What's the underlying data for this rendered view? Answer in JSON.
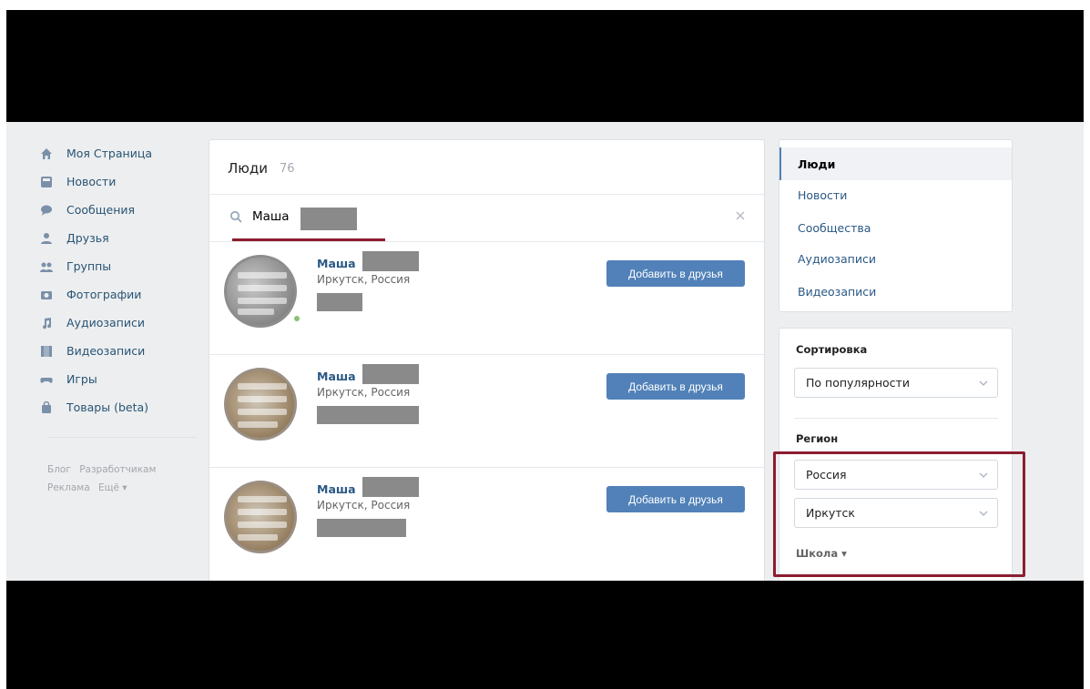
{
  "nav": {
    "items": [
      {
        "label": "Моя Страница",
        "icon": "home-icon"
      },
      {
        "label": "Новости",
        "icon": "news-icon"
      },
      {
        "label": "Сообщения",
        "icon": "messages-icon"
      },
      {
        "label": "Друзья",
        "icon": "friends-icon"
      },
      {
        "label": "Группы",
        "icon": "groups-icon"
      },
      {
        "label": "Фотографии",
        "icon": "camera-icon"
      },
      {
        "label": "Аудиозаписи",
        "icon": "music-icon"
      },
      {
        "label": "Видеозаписи",
        "icon": "video-icon"
      },
      {
        "label": "Игры",
        "icon": "gamepad-icon"
      },
      {
        "label": "Товары (beta)",
        "icon": "shopping-bag-icon"
      }
    ],
    "footer": [
      "Блог",
      "Разработчикам",
      "Реклама",
      "Ещё ▾"
    ]
  },
  "main": {
    "title": "Люди",
    "count": "76",
    "search": {
      "value": "Маша"
    },
    "results": [
      {
        "name": "Маша",
        "city": "Иркутск, Россия",
        "button": "Добавить в друзья"
      },
      {
        "name": "Маша",
        "city": "Иркутск, Россия",
        "button": "Добавить в друзья"
      },
      {
        "name": "Маша",
        "city": "Иркутск, Россия",
        "button": "Добавить в друзья"
      }
    ]
  },
  "filters": {
    "tabs": [
      "Люди",
      "Новости",
      "Сообщества",
      "Аудиозаписи",
      "Видеозаписи"
    ],
    "sort_label": "Сортировка",
    "sort_value": "По популярности",
    "region_label": "Регион",
    "country_value": "Россия",
    "city_value": "Иркутск",
    "school_link": "Школа ▾"
  },
  "colors": {
    "accent": "#5181b8",
    "link": "#2a5885",
    "highlight": "#8c1d2f",
    "background": "#edeef0"
  }
}
